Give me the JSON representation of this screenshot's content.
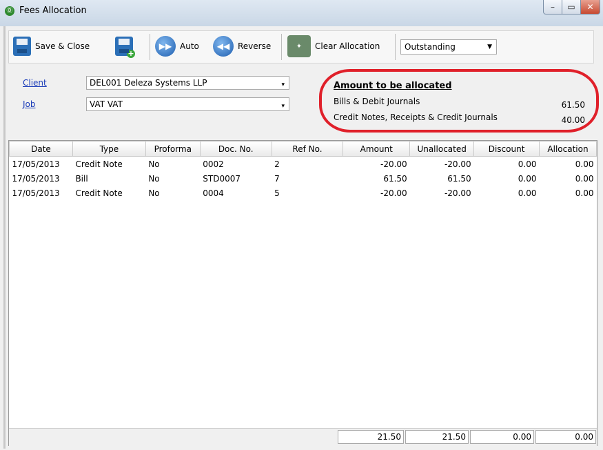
{
  "window": {
    "title": "Fees Allocation",
    "controls": {
      "minimize": "–",
      "maximize": "▭",
      "close": "✕"
    }
  },
  "toolbar": {
    "save_close_label": "Save & Close",
    "auto_label": "Auto",
    "reverse_label": "Reverse",
    "clear_allocation_label": "Clear Allocation",
    "filter_value": "Outstanding"
  },
  "header": {
    "client_label": "Client",
    "client_value": "DEL001   Deleza Systems LLP",
    "job_label": "Job",
    "job_value": "VAT   VAT"
  },
  "summary": {
    "title": "Amount to be allocated",
    "bills_label": "Bills & Debit Journals",
    "bills_value": "61.50",
    "credits_label": "Credit Notes, Receipts & Credit Journals",
    "credits_value": "40.00"
  },
  "grid": {
    "columns": [
      "Date",
      "Type",
      "Proforma",
      "Doc. No.",
      "Ref No.",
      "Amount",
      "Unallocated",
      "Discount",
      "Allocation"
    ],
    "rows": [
      {
        "date": "17/05/2013",
        "type": "Credit Note",
        "proforma": "No",
        "doc_no": "0002",
        "ref_no": "2",
        "amount": "-20.00",
        "unallocated": "-20.00",
        "discount": "0.00",
        "allocation": "0.00"
      },
      {
        "date": "17/05/2013",
        "type": "Bill",
        "proforma": "No",
        "doc_no": "STD0007",
        "ref_no": "7",
        "amount": "61.50",
        "unallocated": "61.50",
        "discount": "0.00",
        "allocation": "0.00"
      },
      {
        "date": "17/05/2013",
        "type": "Credit Note",
        "proforma": "No",
        "doc_no": "0004",
        "ref_no": "5",
        "amount": "-20.00",
        "unallocated": "-20.00",
        "discount": "0.00",
        "allocation": "0.00"
      }
    ],
    "totals": {
      "amount": "21.50",
      "unallocated": "21.50",
      "discount": "0.00",
      "allocation": "0.00"
    }
  },
  "colors": {
    "highlight_ring": "#e0202a",
    "link": "#1a3bb8",
    "toolbar_icon": "#2b6fb7"
  }
}
